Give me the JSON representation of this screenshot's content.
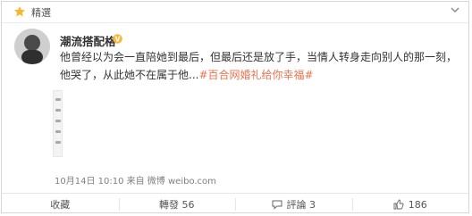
{
  "top_bar": {
    "label": "精選"
  },
  "post": {
    "author": "潮流搭配格",
    "text_main": "他曾经以为会一直陪她到最后，但最后还是放了手，当情人转身走向别人的那一刻，他哭了，从此她不在属于他...",
    "topic": "#百合网婚礼给你幸福#",
    "meta": "10月14日 10:10 来自 微博 weibo.com"
  },
  "actions": {
    "favorite": "收藏",
    "repost": "轉發 56",
    "comment": "評論 3",
    "like_count": "186"
  },
  "colors": {
    "topic": "#eb7350",
    "badge": "#f6b93b"
  }
}
